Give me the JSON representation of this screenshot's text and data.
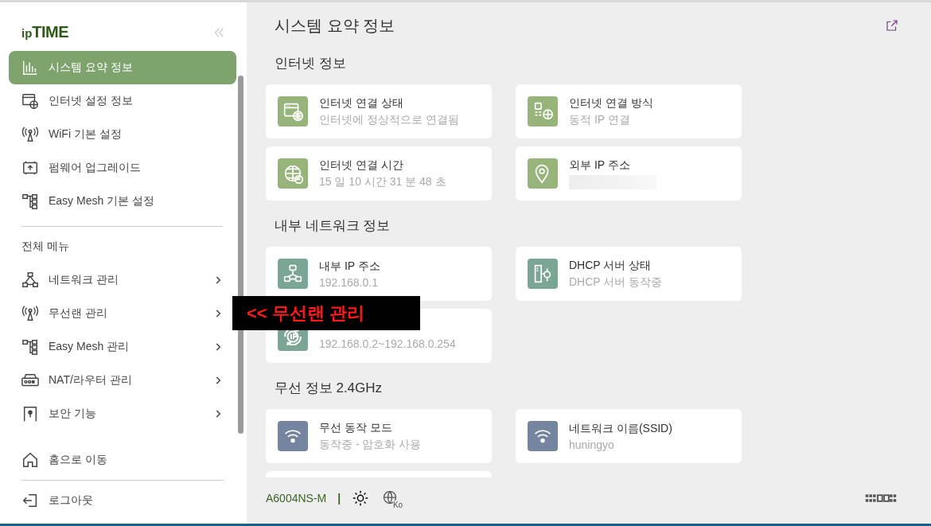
{
  "logo": {
    "prefix": "ip",
    "name": "TIME"
  },
  "quick_menu": [
    {
      "label": "시스템 요약 정보",
      "selected": true
    },
    {
      "label": "인터넷 설정 정보",
      "selected": false
    },
    {
      "label": "WiFi 기본 설정",
      "selected": false
    },
    {
      "label": "펌웨어 업그레이드",
      "selected": false
    },
    {
      "label": "Easy Mesh 기본 설정",
      "selected": false
    }
  ],
  "menu_heading": "전체 메뉴",
  "menu": [
    {
      "label": "네트워크 관리"
    },
    {
      "label": "무선랜 관리"
    },
    {
      "label": "Easy Mesh 관리"
    },
    {
      "label": "NAT/라우터 관리"
    },
    {
      "label": "보안 기능"
    }
  ],
  "bottom_links": [
    {
      "label": "홈으로 이동"
    },
    {
      "label": "로그아웃"
    }
  ],
  "page_title": "시스템 요약 정보",
  "sections": [
    {
      "title": "인터넷 정보",
      "color": "#97b57a",
      "cards": [
        {
          "title": "인터넷 연결 상태",
          "value": "인터넷에 정상적으로 연결됨"
        },
        {
          "title": "인터넷 연결 방식",
          "value": "동적 IP 연결"
        },
        {
          "title": "인터넷 연결 시간",
          "value": "15 일 10 시간 31 분 48 초"
        },
        {
          "title": "외부 IP 주소",
          "blurred": true
        }
      ]
    },
    {
      "title": "내부 네트워크 정보",
      "color": "#7ba594",
      "cards": [
        {
          "title": "내부 IP 주소",
          "value": "192.168.0.1"
        },
        {
          "title": "DHCP 서버 상태",
          "value": "DHCP 서버 동작중"
        },
        {
          "value": "192.168.0.2~192.168.0.254"
        }
      ]
    },
    {
      "title": "무선 정보 2.4GHz",
      "color": "#7585a0",
      "cards": [
        {
          "title": "무선 동작 모드",
          "value": "동작중 - 암호화 사용"
        },
        {
          "title": "네트워크 이름(SSID)",
          "value": "huningyo"
        },
        {
          "partial": true
        }
      ]
    }
  ],
  "footer": {
    "model": "A6004NS-M",
    "separator": "|",
    "language": "Ko"
  },
  "callout": {
    "text": "<< 무선랜 관리"
  }
}
